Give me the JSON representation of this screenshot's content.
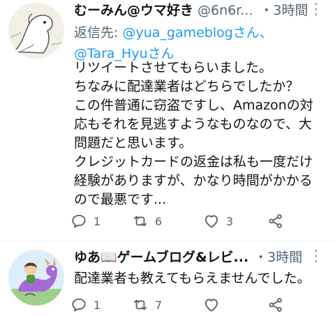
{
  "tweets": [
    {
      "name": "むーみん@ウマ好き",
      "handle": "@6n6r...",
      "time": "・3時間",
      "reply_prefix": "返信先: ",
      "reply_to_1": "@yua_gameblogさん",
      "reply_sep": "、",
      "reply_to_2": "@Tara_Hyuさん",
      "body_lines": [
        "リツイートさせてもらいました。",
        "ちなみに配達業者はどちらでしたか？",
        "この件普通に窃盗ですし、Amazonの対",
        "応もそれを見逃すようなものなので、大",
        "問題だと思います。",
        "クレジットカードの返金は私も一度だけ",
        "経験がありますが、かなり時間がかかる",
        "ので最悪です..."
      ],
      "replies": "1",
      "retweets": "6",
      "likes": "3"
    },
    {
      "name": "ゆあ📖ゲームブログ&レビ...",
      "time": "・3時間",
      "body_lines": [
        "配達業者も教えてもらえませんでした。"
      ],
      "replies": "1",
      "retweets": "7",
      "likes": ""
    }
  ],
  "icons": {
    "reply": "reply-icon",
    "retweet": "retweet-icon",
    "like": "heart-icon",
    "share": "share-icon",
    "more": "more-icon"
  },
  "colors": {
    "link": "#1d9bf0",
    "secondary_text": "#536471",
    "divider": "#e6ecf0"
  }
}
